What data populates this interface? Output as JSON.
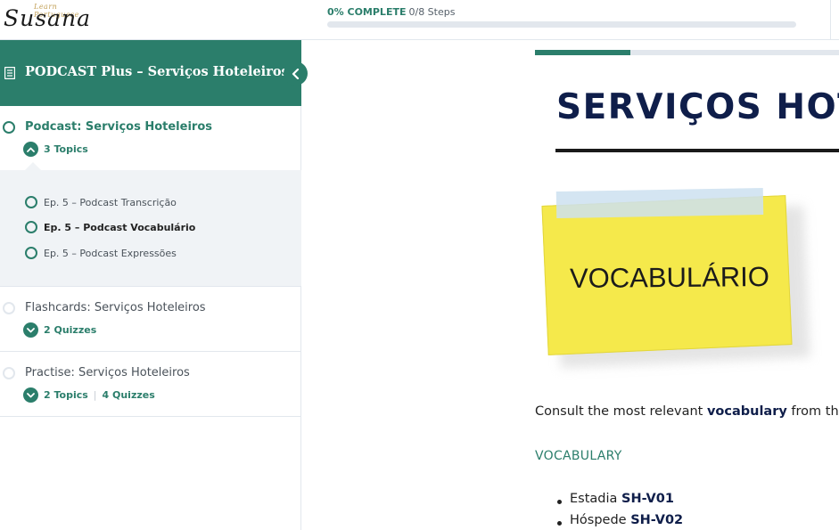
{
  "header": {
    "logo_small": "Learn Portuguese",
    "logo_big": "Susana",
    "progress_percent_label": "0% COMPLETE",
    "progress_steps": "0/8 Steps",
    "progress_value": 0
  },
  "sidebar": {
    "course_title": "PODCAST Plus – Serviços Hoteleiros",
    "lessons": [
      {
        "title": "Podcast: Serviços Hoteleiros",
        "expand_label": "3 Topics",
        "topics": [
          {
            "label": "Ep. 5 – Podcast Transcrição"
          },
          {
            "label": "Ep. 5 – Podcast Vocabulário"
          },
          {
            "label": "Ep. 5 – Podcast Expressões"
          }
        ]
      },
      {
        "title": "Flashcards: Serviços Hoteleiros",
        "expand_label": "2 Quizzes"
      },
      {
        "title": "Practise: Serviços Hoteleiros",
        "expand_label": "2 Topics",
        "expand_label_2": "4 Quizzes"
      }
    ]
  },
  "content": {
    "heading": "SERVIÇOS HOTE",
    "sticky_text": "VOCABULÁRIO",
    "intro_prefix": "Consult the most relevant ",
    "intro_bold": "vocabulary",
    "intro_suffix": " from th",
    "section_label": "VOCABULARY",
    "vocab": [
      {
        "word": "Estadia",
        "code": "SH-V01"
      },
      {
        "word": "Hóspede",
        "code": "SH-V02"
      }
    ]
  },
  "colors": {
    "accent": "#2b7e6b",
    "heading": "#0f1e4a",
    "sticky": "#f5e94b",
    "panel_bg": "#f0f3f6"
  }
}
